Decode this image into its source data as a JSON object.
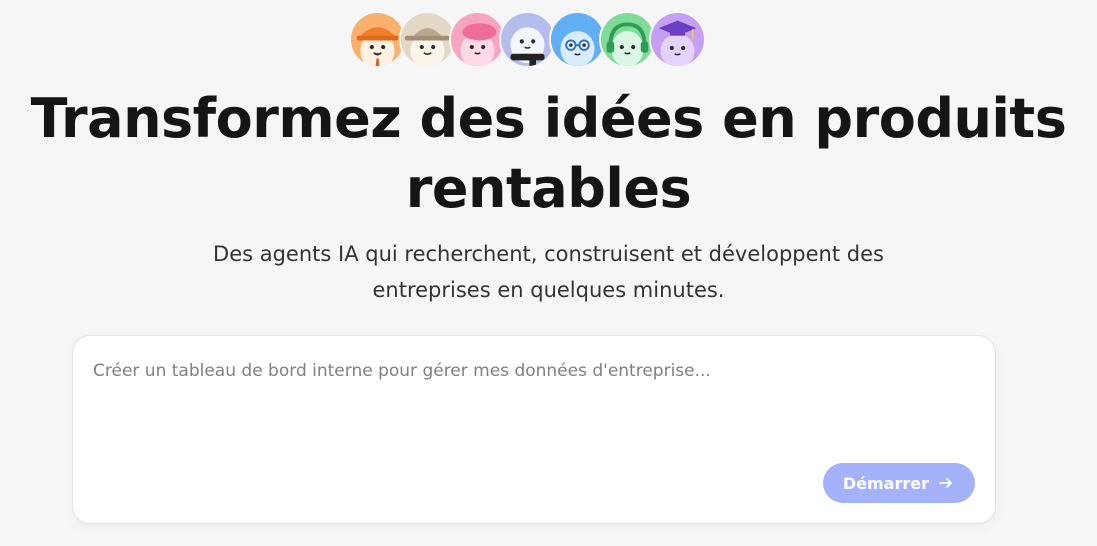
{
  "hero": {
    "headline_line1": "Transformez des idées en produits",
    "headline_line2": "rentables",
    "subtitle_line1": "Des agents IA qui recherchent, construisent et développent des",
    "subtitle_line2": "entreprises en quelques minutes."
  },
  "agents": [
    {
      "icon": "agent-builder-hardhat-icon",
      "color": "#f6a35c"
    },
    {
      "icon": "agent-explorer-hat-icon",
      "color": "#d9cbb8"
    },
    {
      "icon": "agent-pink-beret-icon",
      "color": "#f38fb2"
    },
    {
      "icon": "agent-scarf-icon",
      "color": "#a9b3e6"
    },
    {
      "icon": "agent-glasses-icon",
      "color": "#5eaaf5"
    },
    {
      "icon": "agent-headphones-icon",
      "color": "#6fd28a"
    },
    {
      "icon": "agent-graduate-icon",
      "color": "#b98df0"
    }
  ],
  "prompt": {
    "placeholder": "Créer un tableau de bord interne pour gérer mes données d'entreprise...",
    "value": "",
    "start_label": "Démarrer"
  },
  "colors": {
    "background": "#f6f6f6",
    "button": "#a3b2fb",
    "headline": "#151515"
  }
}
